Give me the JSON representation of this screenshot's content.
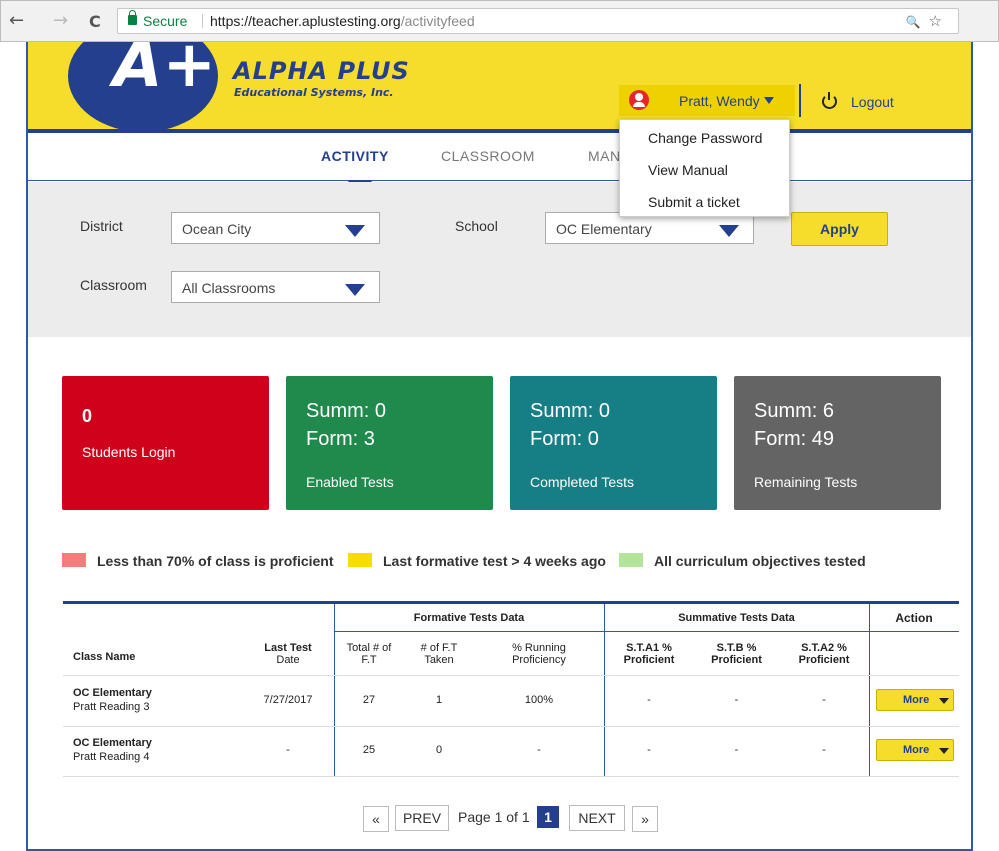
{
  "browser": {
    "back": "←",
    "forward": "→",
    "reload": "C",
    "secure_label": "Secure",
    "url_base": "https://teacher.aplustesting.org",
    "url_path": "/activityfeed",
    "zoom_icon": "🔍",
    "star_icon": "☆"
  },
  "header": {
    "logo_text": "A+",
    "brand_title": "ALPHA PLUS",
    "brand_sub": "Educational Systems, Inc.",
    "user_name": "Pratt, Wendy",
    "logout": "Logout"
  },
  "user_menu": [
    "Change Password",
    "View Manual",
    "Submit a ticket"
  ],
  "nav": {
    "activity": "ACTIVITY",
    "classroom": "CLASSROOM",
    "manage": "MAN"
  },
  "filters": {
    "district_label": "District",
    "district_value": "Ocean City",
    "school_label": "School",
    "school_value": "OC Elementary",
    "classroom_label": "Classroom",
    "classroom_value": "All Classrooms",
    "apply": "Apply"
  },
  "cards": [
    {
      "line1": "0",
      "line2": "",
      "label": "Students Login",
      "color": "#d0021b"
    },
    {
      "line1": "Summ: 0",
      "line2": "Form: 3",
      "label": "Enabled Tests",
      "color": "#1f8a4c"
    },
    {
      "line1": "Summ: 0",
      "line2": "Form: 0",
      "label": "Completed Tests",
      "color": "#167f86"
    },
    {
      "line1": "Summ: 6",
      "line2": "Form: 49",
      "label": "Remaining Tests",
      "color": "#646464"
    }
  ],
  "legend": [
    {
      "text": "Less than 70% of class is proficient",
      "color": "#f47c7c"
    },
    {
      "text": "Last formative test > 4 weeks ago",
      "color": "#f7dd00"
    },
    {
      "text": "All curriculum objectives tested",
      "color": "#b4e39a"
    }
  ],
  "table": {
    "group_formative": "Formative Tests Data",
    "group_summative": "Summative Tests Data",
    "group_action": "Action",
    "cols": {
      "class_name": "Class Name",
      "last_test_1": "Last Test",
      "last_test_2": "Date",
      "total_1": "Total # of",
      "total_2": "F.T",
      "taken_1": "# of F.T",
      "taken_2": "Taken",
      "running_1": "% Running",
      "running_2": "Proficiency",
      "sta1_1": "S.T.A1 %",
      "sta1_2": "Proficient",
      "stb_1": "S.T.B %",
      "stb_2": "Proficient",
      "sta2_1": "S.T.A2 %",
      "sta2_2": "Proficient"
    },
    "rows": [
      {
        "school": "OC Elementary",
        "class": "Pratt Reading 3",
        "last": "7/27/2017",
        "total": "27",
        "taken": "1",
        "running": "100%",
        "sta1": "-",
        "stb": "-",
        "sta2": "-",
        "action": "More"
      },
      {
        "school": "OC Elementary",
        "class": "Pratt Reading 4",
        "last": "-",
        "total": "25",
        "taken": "0",
        "running": "-",
        "sta1": "-",
        "stb": "-",
        "sta2": "-",
        "action": "More"
      }
    ]
  },
  "pagination": {
    "first": "«",
    "prev": "PREV",
    "page_text": "Page 1 of 1",
    "current": "1",
    "next": "NEXT",
    "last": "»"
  }
}
